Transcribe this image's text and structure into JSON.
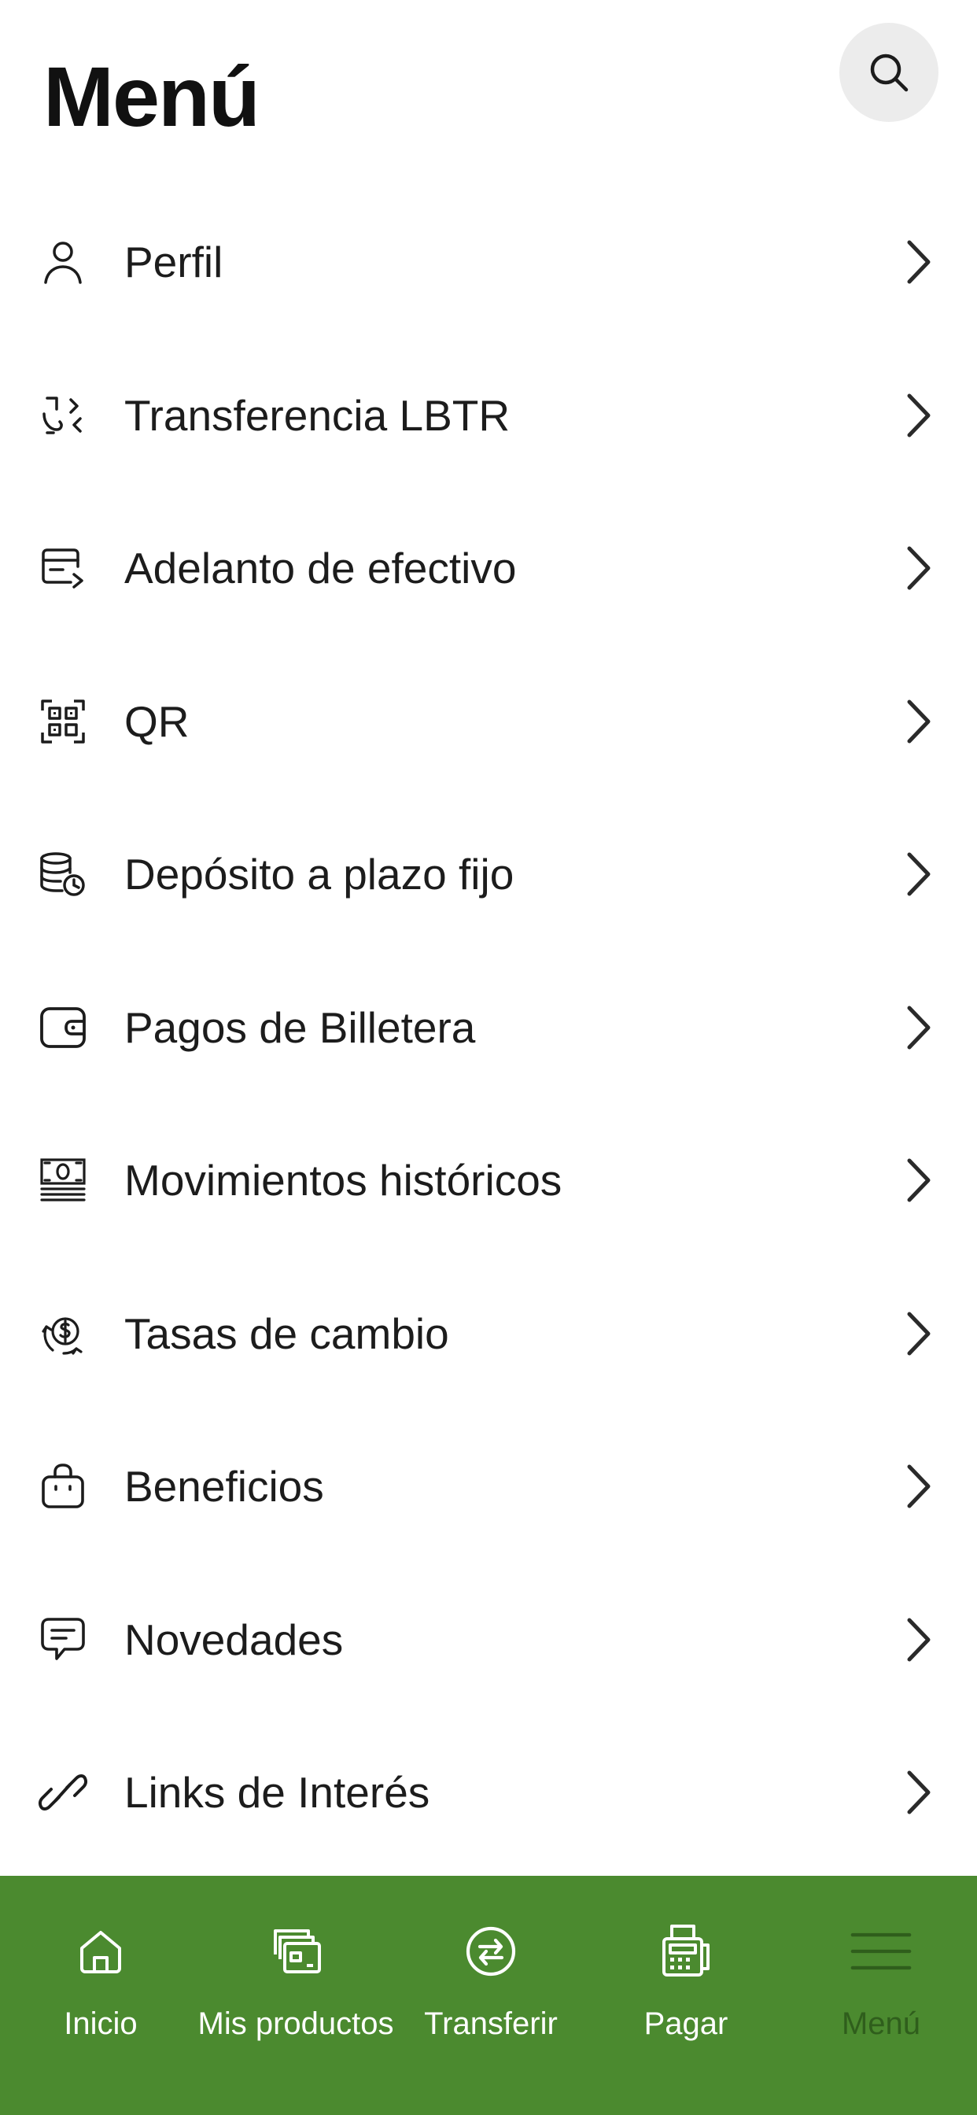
{
  "header": {
    "title": "Menú",
    "search_icon": "search-icon"
  },
  "menu": {
    "items": [
      {
        "label": "Perfil",
        "icon": "user-icon"
      },
      {
        "label": "Transferencia LBTR",
        "icon": "transfer-lbtr-icon"
      },
      {
        "label": "Adelanto de efectivo",
        "icon": "cash-advance-icon"
      },
      {
        "label": "QR",
        "icon": "qr-code-icon"
      },
      {
        "label": "Depósito a plazo fijo",
        "icon": "fixed-deposit-icon"
      },
      {
        "label": "Pagos de Billetera",
        "icon": "wallet-icon"
      },
      {
        "label": "Movimientos históricos",
        "icon": "banknote-history-icon"
      },
      {
        "label": "Tasas de cambio",
        "icon": "exchange-rate-icon"
      },
      {
        "label": "Beneficios",
        "icon": "shopping-bag-icon"
      },
      {
        "label": "Novedades",
        "icon": "chat-bubble-icon"
      },
      {
        "label": "Links de Interés",
        "icon": "link-icon"
      }
    ]
  },
  "tabbar": {
    "background": "#4b8a2f",
    "active_color": "#2f5e1c",
    "tabs": [
      {
        "label": "Inicio",
        "icon": "home-icon"
      },
      {
        "label": "Mis productos",
        "icon": "cards-icon"
      },
      {
        "label": "Transferir",
        "icon": "transfer-icon"
      },
      {
        "label": "Pagar",
        "icon": "pos-terminal-icon"
      },
      {
        "label": "Menú",
        "icon": "menu-lines-icon",
        "active": true
      }
    ]
  }
}
